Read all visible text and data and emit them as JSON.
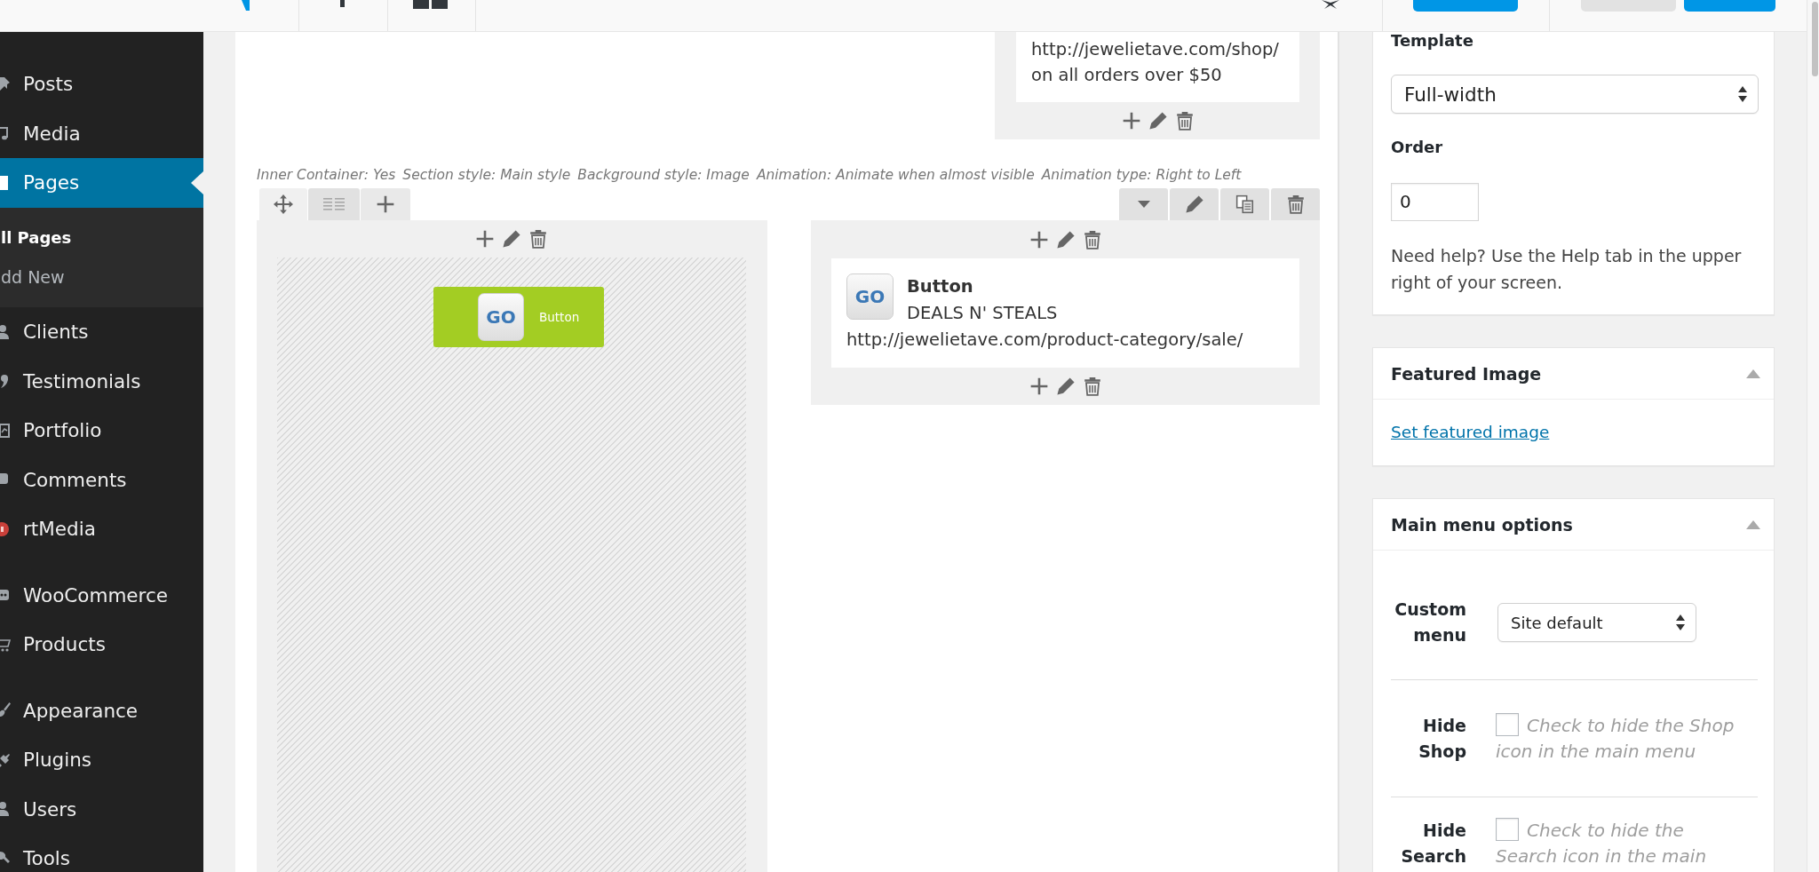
{
  "sidebar": {
    "groups": [
      {
        "items": [
          {
            "label": "Posts",
            "selected": false
          },
          {
            "label": "Media",
            "selected": false
          },
          {
            "label": "Pages",
            "selected": true,
            "children": [
              {
                "label": "ll Pages",
                "selected": true
              },
              {
                "label": "dd New",
                "selected": false
              }
            ]
          },
          {
            "label": "Clients",
            "selected": false
          },
          {
            "label": "Testimonials",
            "selected": false
          },
          {
            "label": "Portfolio",
            "selected": false
          },
          {
            "label": "Comments",
            "selected": false
          },
          {
            "label": "rtMedia",
            "selected": false
          }
        ]
      },
      {
        "items": [
          {
            "label": "WooCommerce",
            "selected": false
          },
          {
            "label": "Products",
            "selected": false
          }
        ]
      },
      {
        "items": [
          {
            "label": "Appearance",
            "selected": false
          },
          {
            "label": "Plugins",
            "selected": false
          },
          {
            "label": "Users",
            "selected": false
          },
          {
            "label": "Tools",
            "selected": false
          }
        ]
      }
    ]
  },
  "builder": {
    "previous_row": {
      "modules": [
        {
          "kind": "text",
          "lines": [
            "http://jewelietave.com/shop/",
            "on all orders over $50"
          ]
        }
      ]
    },
    "row": {
      "settings": [
        "Inner Container: Yes",
        "Section style: Main style",
        "Background style: Image",
        "Animation: Animate when almost visible",
        "Animation type: Right to Left"
      ],
      "columns": [
        {
          "modules": [
            {
              "kind": "preview",
              "badge": "GO",
              "label": "Button"
            }
          ]
        },
        {
          "modules": [
            {
              "kind": "summary",
              "badge": "GO",
              "title": "Button",
              "subtitle": "DEALS N' STEALS",
              "url": "http://jewelietave.com/product-category/sale/"
            }
          ]
        }
      ]
    }
  },
  "page_attributes": {
    "template_label": "Template",
    "template": "Full-width",
    "order_label": "Order",
    "order": "0",
    "help": "Need help? Use the Help tab in the upper right of your screen."
  },
  "metaboxes": [
    {
      "kind": "link",
      "title": "Featured Image",
      "expanded": true,
      "link": "Set featured image"
    },
    {
      "kind": "fields",
      "title": "Main menu options",
      "expanded": true,
      "fields": [
        {
          "kind": "select",
          "label": "Custom menu",
          "value": "Site default"
        },
        {
          "kind": "checkbox",
          "label": "Hide Shop",
          "checked": false,
          "description": "Check to hide the Shop icon in the main menu"
        },
        {
          "kind": "checkbox",
          "label": "Hide Search",
          "checked": false,
          "description": "Check to hide the Search icon in the main"
        }
      ]
    }
  ]
}
